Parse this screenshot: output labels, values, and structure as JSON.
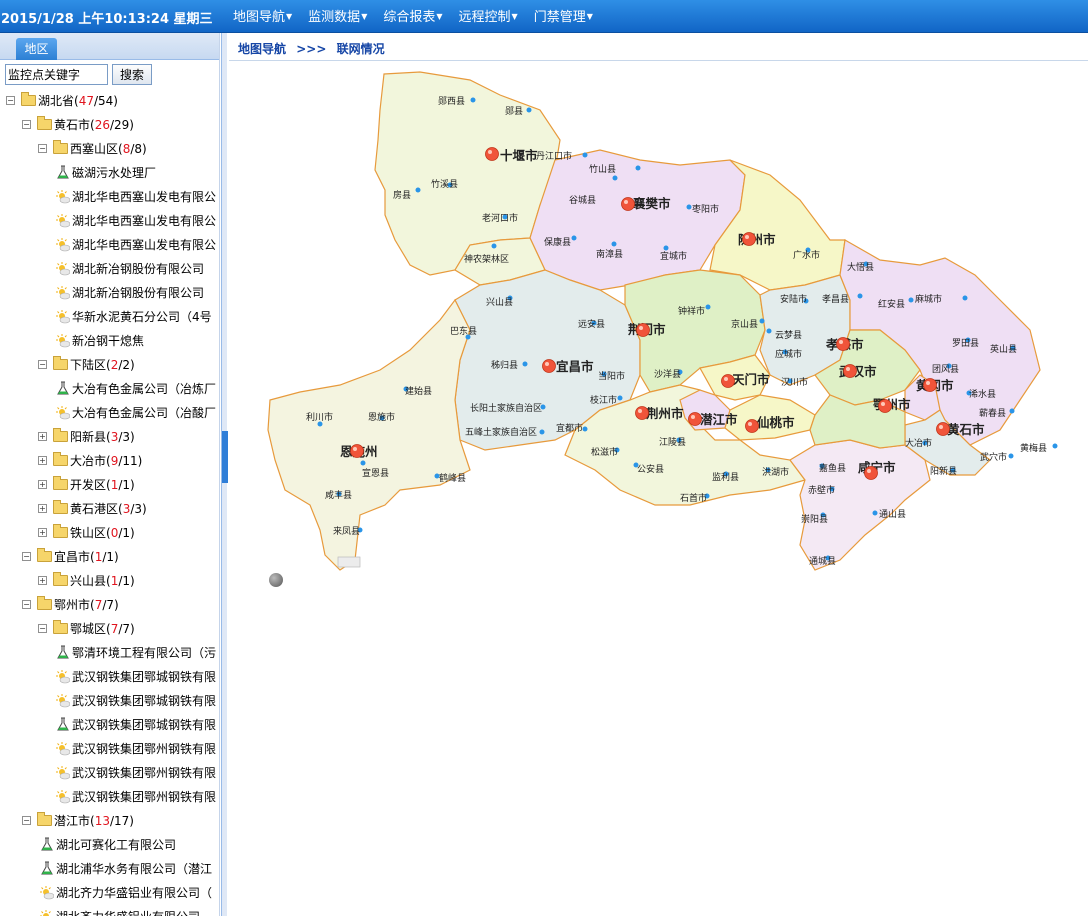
{
  "header": {
    "datetime": "2015/1/28 上午10:13:24 星期三",
    "menu": [
      {
        "label": "地图导航"
      },
      {
        "label": "监测数据"
      },
      {
        "label": "综合报表"
      },
      {
        "label": "远程控制"
      },
      {
        "label": "门禁管理"
      }
    ]
  },
  "sidebar": {
    "tab": "地区",
    "search_placeholder": "监控点关键字",
    "search_button": "搜索",
    "tree": [
      {
        "level": 0,
        "type": "folder",
        "open": true,
        "name": "湖北省(",
        "red": "47",
        "rest": "/54)"
      },
      {
        "level": 1,
        "type": "folder",
        "open": true,
        "name": "黄石市(",
        "red": "26",
        "rest": "/29)"
      },
      {
        "level": 2,
        "type": "folder",
        "open": true,
        "name": "西塞山区(",
        "red": "8",
        "rest": "/8)"
      },
      {
        "level": 3,
        "type": "flask",
        "name": "磁湖污水处理厂"
      },
      {
        "level": 3,
        "type": "sun",
        "name": "湖北华电西塞山发电有限公"
      },
      {
        "level": 3,
        "type": "sun",
        "name": "湖北华电西塞山发电有限公"
      },
      {
        "level": 3,
        "type": "sun",
        "name": "湖北华电西塞山发电有限公"
      },
      {
        "level": 3,
        "type": "sun",
        "name": "湖北新冶钢股份有限公司"
      },
      {
        "level": 3,
        "type": "sun",
        "name": "湖北新冶钢股份有限公司"
      },
      {
        "level": 3,
        "type": "sun",
        "name": "华新水泥黄石分公司（4号"
      },
      {
        "level": 3,
        "type": "sun",
        "name": "新冶钢干熄焦"
      },
      {
        "level": 2,
        "type": "folder",
        "open": true,
        "name": "下陆区(",
        "red": "2",
        "rest": "/2)"
      },
      {
        "level": 3,
        "type": "flask",
        "name": "大冶有色金属公司（冶炼厂"
      },
      {
        "level": 3,
        "type": "sun",
        "name": "大冶有色金属公司（冶酸厂"
      },
      {
        "level": 2,
        "type": "folder",
        "open": false,
        "name": "阳新县(",
        "red": "3",
        "rest": "/3)"
      },
      {
        "level": 2,
        "type": "folder",
        "open": false,
        "name": "大冶市(",
        "red": "9",
        "rest": "/11)"
      },
      {
        "level": 2,
        "type": "folder",
        "open": false,
        "name": "开发区(",
        "red": "1",
        "rest": "/1)"
      },
      {
        "level": 2,
        "type": "folder",
        "open": false,
        "name": "黄石港区(",
        "red": "3",
        "rest": "/3)"
      },
      {
        "level": 2,
        "type": "folder",
        "open": false,
        "name": "铁山区(",
        "red": "0",
        "rest": "/1)"
      },
      {
        "level": 1,
        "type": "folder",
        "open": true,
        "name": "宜昌市(",
        "red": "1",
        "rest": "/1)"
      },
      {
        "level": 2,
        "type": "folder",
        "open": false,
        "name": "兴山县(",
        "red": "1",
        "rest": "/1)"
      },
      {
        "level": 1,
        "type": "folder",
        "open": true,
        "name": "鄂州市(",
        "red": "7",
        "rest": "/7)"
      },
      {
        "level": 2,
        "type": "folder",
        "open": true,
        "name": "鄂城区(",
        "red": "7",
        "rest": "/7)"
      },
      {
        "level": 3,
        "type": "flask",
        "name": "鄂清环境工程有限公司（污"
      },
      {
        "level": 3,
        "type": "sun",
        "name": "武汉钢铁集团鄂城钢铁有限"
      },
      {
        "level": 3,
        "type": "sun",
        "name": "武汉钢铁集团鄂城钢铁有限"
      },
      {
        "level": 3,
        "type": "flask",
        "name": "武汉钢铁集团鄂城钢铁有限"
      },
      {
        "level": 3,
        "type": "sun",
        "name": "武汉钢铁集团鄂州钢铁有限"
      },
      {
        "level": 3,
        "type": "sun",
        "name": "武汉钢铁集团鄂州钢铁有限"
      },
      {
        "level": 3,
        "type": "sun",
        "name": "武汉钢铁集团鄂州钢铁有限"
      },
      {
        "level": 1,
        "type": "folder",
        "open": true,
        "name": "潜江市(",
        "red": "13",
        "rest": "/17)"
      },
      {
        "level": 2,
        "type": "flask",
        "name": "湖北可赛化工有限公司"
      },
      {
        "level": 2,
        "type": "flask",
        "name": "湖北浦华水务有限公司（潜江"
      },
      {
        "level": 2,
        "type": "sun",
        "name": "湖北齐力华盛铝业有限公司（"
      },
      {
        "level": 2,
        "type": "sun",
        "name": "湖北齐力华盛铝业有限公司"
      }
    ]
  },
  "breadcrumb": {
    "root": "地图导航",
    "sep": ">>>",
    "current": "联网情况"
  },
  "map": {
    "cities": [
      {
        "name": "十堰市"
      },
      {
        "name": "襄樊市"
      },
      {
        "name": "随州市"
      },
      {
        "name": "荆门市"
      },
      {
        "name": "宜昌市"
      },
      {
        "name": "孝感市"
      },
      {
        "name": "武汉市"
      },
      {
        "name": "黄冈市"
      },
      {
        "name": "鄂州市"
      },
      {
        "name": "黄石市"
      },
      {
        "name": "荆州市"
      },
      {
        "name": "咸宁市"
      },
      {
        "name": "天门市"
      },
      {
        "name": "潜江市"
      },
      {
        "name": "仙桃市"
      },
      {
        "name": "恩施州"
      }
    ],
    "counties": [
      {
        "name": "郧西县"
      },
      {
        "name": "郧县"
      },
      {
        "name": "丹江口市"
      },
      {
        "name": "竹山县"
      },
      {
        "name": "竹溪县"
      },
      {
        "name": "房县"
      },
      {
        "name": "老河口市"
      },
      {
        "name": "谷城县"
      },
      {
        "name": "枣阳市"
      },
      {
        "name": "保康县"
      },
      {
        "name": "南漳县"
      },
      {
        "name": "宜城市"
      },
      {
        "name": "神农架林区"
      },
      {
        "name": "广水市"
      },
      {
        "name": "大悟县"
      },
      {
        "name": "兴山县"
      },
      {
        "name": "钟祥市"
      },
      {
        "name": "京山县"
      },
      {
        "name": "安陆市"
      },
      {
        "name": "孝昌县"
      },
      {
        "name": "红安县"
      },
      {
        "name": "麻城市"
      },
      {
        "name": "巴东县"
      },
      {
        "name": "远安县"
      },
      {
        "name": "云梦县"
      },
      {
        "name": "应城市"
      },
      {
        "name": "罗田县"
      },
      {
        "name": "英山县"
      },
      {
        "name": "秭归县"
      },
      {
        "name": "当阳市"
      },
      {
        "name": "沙洋县"
      },
      {
        "name": "汉川市"
      },
      {
        "name": "团风县"
      },
      {
        "name": "浠水县"
      },
      {
        "name": "建始县"
      },
      {
        "name": "长阳土家族自治区"
      },
      {
        "name": "枝江市"
      },
      {
        "name": "蕲春县"
      },
      {
        "name": "利川市"
      },
      {
        "name": "恩施市"
      },
      {
        "name": "五峰土家族自治区"
      },
      {
        "name": "宜都市"
      },
      {
        "name": "大冶市"
      },
      {
        "name": "武穴市"
      },
      {
        "name": "黄梅县"
      },
      {
        "name": "松滋市"
      },
      {
        "name": "江陵县"
      },
      {
        "name": "公安县"
      },
      {
        "name": "监利县"
      },
      {
        "name": "洪湖市"
      },
      {
        "name": "嘉鱼县"
      },
      {
        "name": "阳新县"
      },
      {
        "name": "宣恩县"
      },
      {
        "name": "鹤峰县"
      },
      {
        "name": "赤壁市"
      },
      {
        "name": "石首市"
      },
      {
        "name": "咸丰县"
      },
      {
        "name": "崇阳县"
      },
      {
        "name": "通山县"
      },
      {
        "name": "来凤县"
      },
      {
        "name": "通城县"
      }
    ]
  }
}
